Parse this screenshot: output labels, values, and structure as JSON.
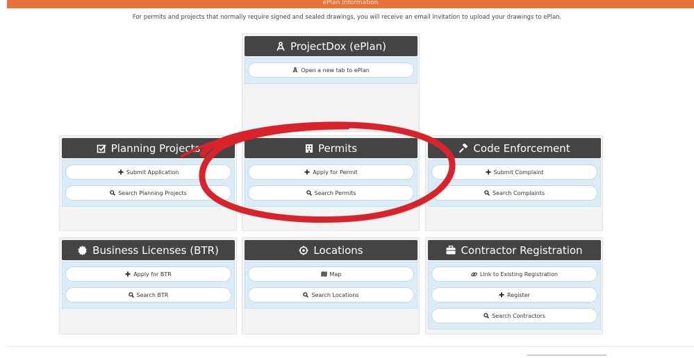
{
  "banner": {
    "text": "ePlan Information"
  },
  "intro_text": "For permits and projects that normally require signed and sealed drawings, you will receive an email invitation to upload your drawings to ePlan.",
  "colors": {
    "header_bg": "#444444",
    "body_bg": "#d9ecf8",
    "banner": "#e8733a",
    "annotation": "#d9232a"
  },
  "panels": {
    "projectdox": {
      "title": "ProjectDox (ePlan)",
      "icon": "compass-icon",
      "buttons": [
        "Open a new tab to ePlan"
      ]
    },
    "planning": {
      "title": "Planning Projects",
      "icon": "checkbox-icon",
      "buttons": [
        "Submit Application",
        "Search Planning Projects"
      ]
    },
    "permits": {
      "title": "Permits",
      "icon": "building-icon",
      "buttons": [
        "Apply for Permit",
        "Search Permits"
      ]
    },
    "code": {
      "title": "Code Enforcement",
      "icon": "gavel-icon",
      "buttons": [
        "Submit Complaint",
        "Search Complaints"
      ]
    },
    "btr": {
      "title": "Business Licenses (BTR)",
      "icon": "certificate-icon",
      "buttons": [
        "Apply for BTR",
        "Search BTR"
      ]
    },
    "locations": {
      "title": "Locations",
      "icon": "crosshairs-icon",
      "buttons": [
        "Map",
        "Search Locations"
      ]
    },
    "contractor": {
      "title": "Contractor Registration",
      "icon": "briefcase-icon",
      "buttons": [
        "Link to Existing Registration",
        "Register",
        "Search Contractors"
      ]
    }
  }
}
